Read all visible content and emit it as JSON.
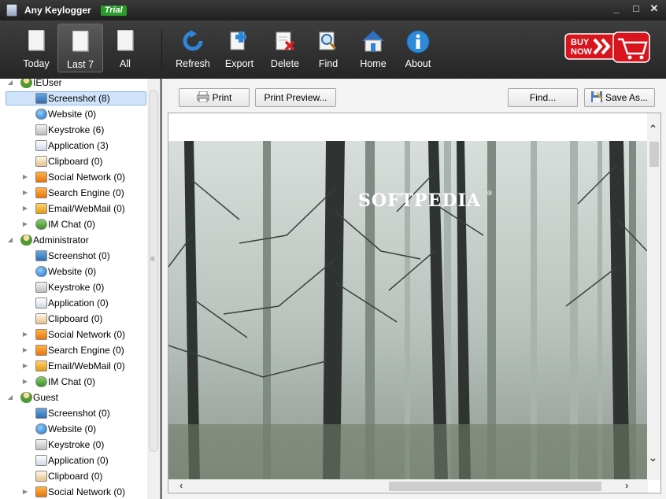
{
  "window": {
    "title": "Any Keylogger",
    "badge": "Trial",
    "controls": {
      "minimize": "_",
      "maximize": "□",
      "close": "✕"
    }
  },
  "toolbar": {
    "today": "Today",
    "last7": "Last 7",
    "all": "All",
    "refresh": "Refresh",
    "export": "Export",
    "delete": "Delete",
    "find": "Find",
    "home": "Home",
    "about": "About",
    "buy_now_line1": "BUY",
    "buy_now_line2": "NOW"
  },
  "tree": {
    "users": [
      {
        "name": "IEUser",
        "items": [
          "Screenshot (8)",
          "Website (0)",
          "Keystroke (6)",
          "Application (3)",
          "Clipboard (0)",
          "Social Network (0)",
          "Search Engine (0)",
          "Email/WebMail (0)",
          "IM Chat (0)"
        ]
      },
      {
        "name": "Administrator",
        "items": [
          "Screenshot (0)",
          "Website (0)",
          "Keystroke (0)",
          "Application (0)",
          "Clipboard (0)",
          "Social Network (0)",
          "Search Engine (0)",
          "Email/WebMail (0)",
          "IM Chat (0)"
        ]
      },
      {
        "name": "Guest",
        "items": [
          "Screenshot (0)",
          "Website (0)",
          "Keystroke (0)",
          "Application (0)",
          "Clipboard (0)",
          "Social Network (0)"
        ]
      }
    ],
    "selected": "IEUser / Screenshot (8)"
  },
  "viewer": {
    "print": "Print",
    "print_preview": "Print Preview...",
    "find": "Find...",
    "save_as": "Save As...",
    "watermark": "SOFTPEDIA",
    "watermark_mark": "®"
  },
  "colors": {
    "toolbar_bg": "#2f2f2f",
    "selection": "#cfe4fa",
    "trial_green": "#2a9c2a",
    "buy_red": "#d8141c"
  }
}
